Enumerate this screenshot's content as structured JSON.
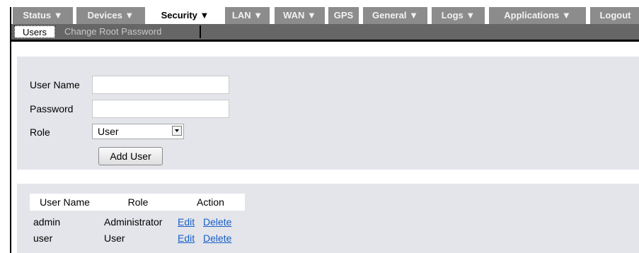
{
  "nav": {
    "tabs": [
      {
        "label": "Status ▼"
      },
      {
        "label": "Devices ▼"
      },
      {
        "label": "Security ▼"
      },
      {
        "label": "LAN ▼"
      },
      {
        "label": "WAN ▼"
      },
      {
        "label": "GPS"
      },
      {
        "label": "General ▼"
      },
      {
        "label": "Logs ▼"
      },
      {
        "label": "Applications ▼"
      },
      {
        "label": "Logout"
      }
    ],
    "active": "Security ▼"
  },
  "subnav": {
    "tabs": [
      {
        "label": "Users"
      },
      {
        "label": "Change Root Password"
      }
    ],
    "active": "Users"
  },
  "form": {
    "username_label": "User Name",
    "username_value": "",
    "password_label": "Password",
    "password_value": "",
    "role_label": "Role",
    "role_value": "User",
    "add_button": "Add User"
  },
  "users_table": {
    "headers": [
      "User Name",
      "Role",
      "Action"
    ],
    "rows": [
      {
        "username": "admin",
        "role": "Administrator",
        "edit": "Edit",
        "delete": "Delete"
      },
      {
        "username": "user",
        "role": "User",
        "edit": "Edit",
        "delete": "Delete"
      }
    ]
  },
  "colors": {
    "tab_bg": "#8c8c8c",
    "subnav_bg": "#666666",
    "panel_bg": "#e3e5ea",
    "link": "#1a5fc8"
  }
}
